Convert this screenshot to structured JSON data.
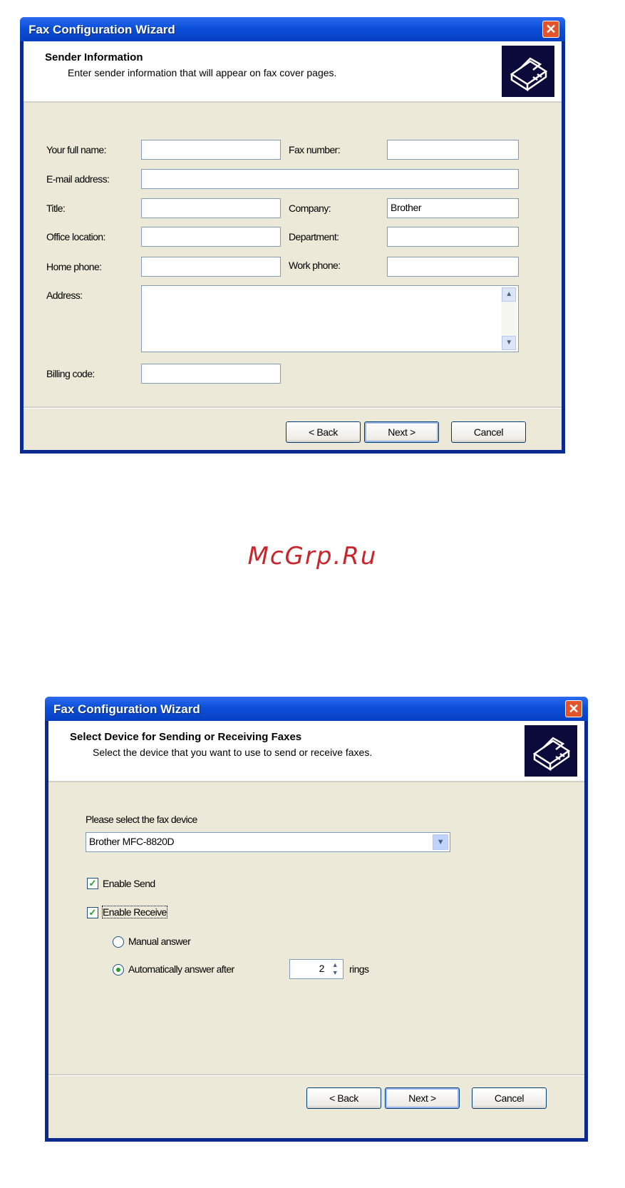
{
  "dialog1": {
    "title": "Fax Configuration Wizard",
    "header_title": "Sender Information",
    "header_subtitle": "Enter sender information that will appear on fax cover pages.",
    "labels": {
      "full_name": "Your full name:",
      "fax_number": "Fax number:",
      "email": "E-mail address:",
      "title": "Title:",
      "company": "Company:",
      "office": "Office location:",
      "department": "Department:",
      "home_phone": "Home phone:",
      "work_phone": "Work phone:",
      "address": "Address:",
      "billing": "Billing code:"
    },
    "values": {
      "full_name": "",
      "fax_number": "",
      "email": "",
      "title": "",
      "company": "Brother",
      "office": "",
      "department": "",
      "home_phone": "",
      "work_phone": "",
      "address": "",
      "billing": ""
    },
    "buttons": {
      "back": "< Back",
      "next": "Next >",
      "cancel": "Cancel"
    }
  },
  "watermark": "McGrp.Ru",
  "dialog2": {
    "title": "Fax Configuration Wizard",
    "header_title": "Select Device for Sending or Receiving Faxes",
    "header_subtitle": "Select the device that you want to use to send or receive faxes.",
    "device_label": "Please select the fax device",
    "device_value": "Brother MFC-8820D",
    "enable_send": "Enable Send",
    "enable_receive": "Enable Receive",
    "manual_answer": "Manual answer",
    "auto_answer": "Automatically answer after",
    "rings_value": "2",
    "rings_label": "rings",
    "enable_send_checked": true,
    "enable_receive_checked": true,
    "auto_answer_selected": true,
    "buttons": {
      "back": "< Back",
      "next": "Next >",
      "cancel": "Cancel"
    }
  },
  "colors": {
    "titlebar": "#0b4fd8",
    "dialog_body": "#ece9d8",
    "check": "#21a121",
    "watermark": "#c8262c"
  }
}
